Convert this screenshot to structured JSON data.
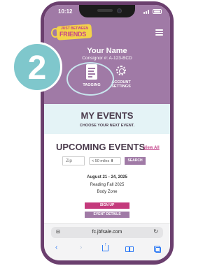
{
  "status_bar": {
    "time": "10:12"
  },
  "step": {
    "number": "2"
  },
  "header": {
    "logo_line1": "JUST BETWEEN",
    "logo_line2": "FRIENDS",
    "user_name": "Your Name",
    "consignor_id": "Consignor #: A-123-BCD",
    "tiles": [
      {
        "label": "TAGGING",
        "icon": "tag-document-icon"
      },
      {
        "label_line1": "ACCOUNT",
        "label_line2": "SETTINGS",
        "icon": "gear-icon"
      }
    ]
  },
  "my_events": {
    "title": "MY EVENTS",
    "subtitle": "CHOOSE YOUR NEXT EVENT."
  },
  "upcoming": {
    "title": "UPCOMING EVENTS",
    "view_all": "View All",
    "zip_placeholder": "Zip",
    "miles_selected": "< 50 miles",
    "search_label": "SEARCH"
  },
  "event": {
    "dates": "August 21 - 24, 2025",
    "name": "Reading Fall 2025",
    "zone": "Body Zone",
    "signup_label": "SIGN UP",
    "details_label": "EVENT DETAILS"
  },
  "browser": {
    "url": "fc.jbfsale.com"
  },
  "colors": {
    "brand_purple": "#a07aa6",
    "frame_purple": "#6b3f6e",
    "signup_pink": "#c43a7c",
    "teal_badge": "#7fc7cc",
    "ios_blue": "#2f7bf5"
  }
}
